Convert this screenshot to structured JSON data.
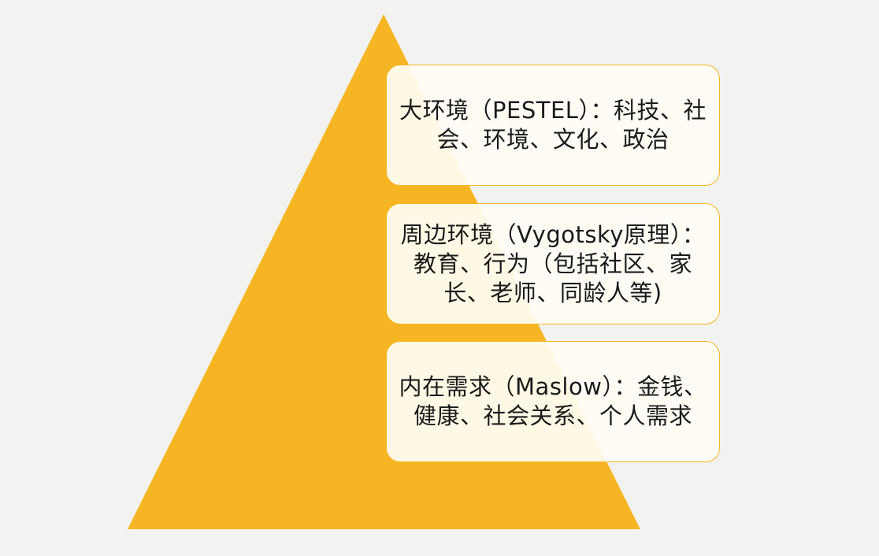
{
  "colors": {
    "background": "#f2f2f0",
    "pyramid": "#f6b623",
    "box_fill": "#fffdf4",
    "box_border": "#f6b623",
    "text": "#1a1a1a"
  },
  "levels": [
    {
      "text": "大环境（PESTEL）：科技、社会、环境、文化、政治"
    },
    {
      "text": "周边环境（Vygotsky原理）：教育、行为（包括社区、家长、老师、同龄人等)"
    },
    {
      "text": "内在需求（Maslow）：金钱、健康、社会关系、个人需求"
    }
  ]
}
